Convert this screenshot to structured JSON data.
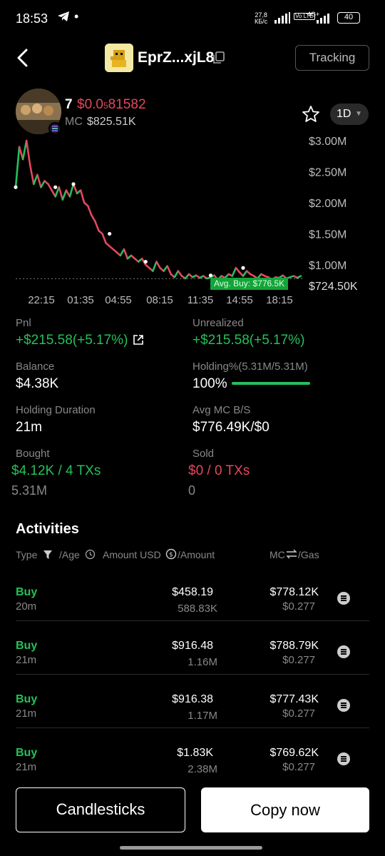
{
  "status_bar": {
    "time": "18:53",
    "dot": "•",
    "speed_value": "27,8",
    "speed_unit": "КБ/с",
    "volte": "Vo LTE",
    "net": "4G+",
    "battery": "40"
  },
  "header": {
    "token_name": "EprZ...xjL8",
    "tracking_label": "Tracking"
  },
  "wallet": {
    "number": "7",
    "price_prefix": "$0.0",
    "price_sub": "5",
    "price_digits": "81582",
    "mc_label": "MC",
    "mc_value": "$825.51K",
    "timeframe": "1D"
  },
  "chart_data": {
    "type": "line",
    "y_ticks": [
      "$3.00M",
      "$2.50M",
      "$2.00M",
      "$1.50M",
      "$1.00M"
    ],
    "current_label": "$724.50K",
    "x_ticks": [
      "22:15",
      "01:35",
      "04:55",
      "08:15",
      "11:35",
      "14:55",
      "18:15"
    ],
    "avg_buy_label": "Avg. Buy: $776.5K",
    "ylim": [
      700000,
      3000000
    ],
    "colors": {
      "up": "#25c05a",
      "down": "#e5475d"
    },
    "series": [
      {
        "x": [
          0,
          1,
          2,
          3,
          4,
          5,
          6,
          7,
          8,
          9,
          10,
          11,
          12,
          13,
          14,
          15,
          16,
          17,
          18,
          19,
          20,
          21,
          22,
          23,
          24,
          25,
          26,
          27,
          28,
          29,
          30,
          31,
          32,
          33,
          34,
          35,
          36,
          37,
          38,
          39,
          40,
          41,
          42,
          43,
          44,
          45,
          46,
          47,
          48,
          49,
          50,
          51,
          52,
          53,
          54,
          55,
          56,
          57,
          58,
          59,
          60,
          61,
          62,
          63,
          64,
          65,
          66,
          67,
          68,
          69,
          70,
          71,
          72,
          73,
          74,
          75,
          76,
          77,
          78,
          79
        ],
        "y": [
          2250000,
          2900000,
          2700000,
          3000000,
          2600000,
          2300000,
          2450000,
          2250000,
          2350000,
          2300000,
          2200000,
          2100000,
          2250000,
          2050000,
          2200000,
          2100000,
          2300000,
          2150000,
          2200000,
          2000000,
          1950000,
          1800000,
          1700000,
          1550000,
          1500000,
          1350000,
          1300000,
          1250000,
          1200000,
          1150000,
          1250000,
          1100000,
          1150000,
          1100000,
          1050000,
          1100000,
          1000000,
          950000,
          900000,
          1050000,
          950000,
          900000,
          980000,
          850000,
          800000,
          900000,
          820000,
          780000,
          850000,
          800000,
          830000,
          790000,
          820000,
          780000,
          800000,
          830000,
          760000,
          820000,
          790000,
          850000,
          820000,
          950000,
          880000,
          820000,
          900000,
          850000,
          820000,
          780000,
          850000,
          820000,
          800000,
          760000,
          800000,
          790000,
          830000,
          780000,
          800000,
          820000,
          790000,
          820000
        ],
        "up": [
          true,
          true,
          false,
          true,
          false,
          false,
          true,
          false,
          true,
          false,
          false,
          false,
          true,
          false,
          true,
          false,
          true,
          false,
          true,
          false,
          false,
          false,
          false,
          false,
          false,
          false,
          false,
          false,
          false,
          false,
          true,
          false,
          true,
          false,
          false,
          true,
          false,
          false,
          false,
          true,
          false,
          false,
          true,
          false,
          false,
          true,
          false,
          false,
          true,
          false,
          true,
          false,
          true,
          false,
          true,
          true,
          false,
          true,
          false,
          true,
          false,
          true,
          false,
          false,
          true,
          false,
          false,
          false,
          true,
          false,
          false,
          false,
          true,
          false,
          true,
          false,
          true,
          true,
          false,
          true
        ]
      }
    ],
    "markers": [
      [
        0,
        2250000
      ],
      [
        11,
        2250000
      ],
      [
        16,
        2300000
      ],
      [
        26,
        1500000
      ],
      [
        36,
        1050000
      ],
      [
        54,
        830000
      ],
      [
        63,
        950000
      ]
    ]
  },
  "stats": {
    "pnl_label": "Pnl",
    "pnl_value": "+$215.58(+5.17%)",
    "unrealized_label": "Unrealized",
    "unrealized_value": "+$215.58(+5.17%)",
    "balance_label": "Balance",
    "balance_value": "$4.38K",
    "holding_label": "Holding%(5.31M/5.31M)",
    "holding_value": "100%",
    "holding_fraction": 1.0,
    "duration_label": "Holding Duration",
    "duration_value": "21m",
    "avgmc_label": "Avg MC B/S",
    "avgmc_value": "$776.49K/$0",
    "bought_label": "Bought",
    "bought_value": "$4.12K / 4 TXs",
    "bought_qty": "5.31M",
    "sold_label": "Sold",
    "sold_value": "$0 / 0 TXs",
    "sold_qty": "0"
  },
  "activities": {
    "title": "Activities",
    "col_type": "Type",
    "col_age": "/Age",
    "col_amount": "Amount USD",
    "col_amount2": "/Amount",
    "col_mc": "MC",
    "col_gas": "/Gas",
    "rows": [
      {
        "type": "Buy",
        "age": "20m",
        "amount_usd": "$458.19",
        "amount": "588.83K",
        "mc": "$778.12K",
        "gas": "$0.277"
      },
      {
        "type": "Buy",
        "age": "21m",
        "amount_usd": "$916.48",
        "amount": "1.16M",
        "mc": "$788.79K",
        "gas": "$0.277"
      },
      {
        "type": "Buy",
        "age": "21m",
        "amount_usd": "$916.38",
        "amount": "1.17M",
        "mc": "$777.43K",
        "gas": "$0.277"
      },
      {
        "type": "Buy",
        "age": "21m",
        "amount_usd": "$1.83K",
        "amount": "2.38M",
        "mc": "$769.62K",
        "gas": "$0.277"
      }
    ]
  },
  "buttons": {
    "candlesticks": "Candlesticks",
    "copy_now": "Copy now"
  }
}
